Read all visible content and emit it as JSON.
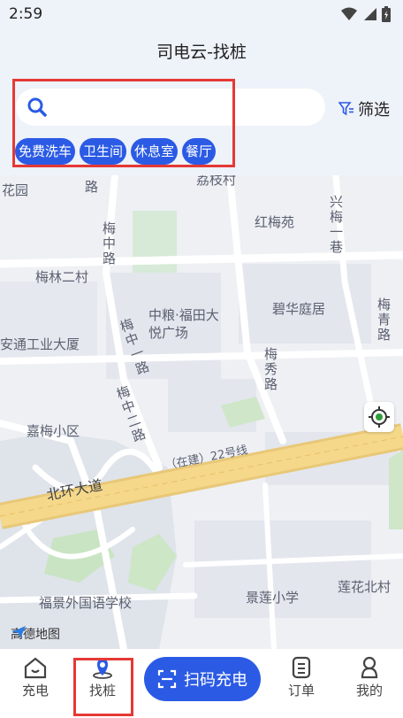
{
  "status_bar": {
    "time": "2:59"
  },
  "header": {
    "title": "司电云-找桩"
  },
  "search": {
    "placeholder": ""
  },
  "filter": {
    "label": "筛选"
  },
  "tags": [
    "免费洗车",
    "卫生间",
    "休息室",
    "餐厅"
  ],
  "map": {
    "labels": {
      "huayuan": "花园",
      "lizhicun": "荔枝村",
      "road_lu": "路",
      "hongmeiyuan": "红梅苑",
      "xingmeiyixiang": "兴梅一巷",
      "meizhonglu": "梅中路",
      "meilinercun": "梅林二村",
      "zhongliangfutian": "中粮·福田大悦广场",
      "bihuatingju": "碧华庭居",
      "meiqinglu": "梅青路",
      "antonggongye": "安通工业大厦",
      "meizhongyilu": "梅中一路",
      "meixiulu": "梅秀路",
      "meizhongerlu": "梅中二路",
      "jiameixiaoqu": "嘉梅小区",
      "zaijian22": "（在建）22号线",
      "beihuandadao": "北环大道",
      "jinglianxiaoxue": "景莲小学",
      "lianhuabeicun": "莲花北村",
      "fujingwaiguoyu": "福景外国语学校"
    },
    "logo": "高德地图"
  },
  "tabbar": {
    "charge": "充电",
    "find_pile": "找桩",
    "scan": "扫码充电",
    "orders": "订单",
    "mine": "我的"
  }
}
